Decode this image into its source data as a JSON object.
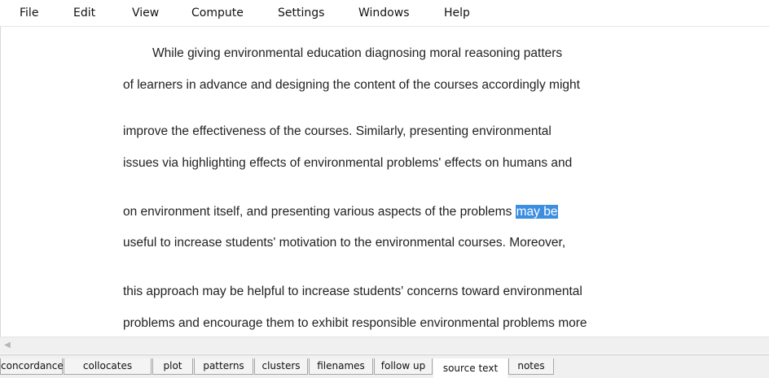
{
  "menu": [
    "File",
    "Edit",
    "View",
    "Compute",
    "Settings",
    "Windows",
    "Help"
  ],
  "text_lines": [
    "While giving environmental education diagnosing moral reasoning patters",
    "of learners in advance and designing the content of the courses accordingly might",
    "improve the effectiveness of the courses. Similarly, presenting environmental",
    "issues via highlighting effects of environmental problems' effects on humans and",
    "on environment itself, and presenting various aspects of the problems ",
    "useful to increase students' motivation to the environmental courses. Moreover,",
    "this approach may be helpful to increase students' concerns toward environmental",
    "problems and encourage them to exhibit responsible environmental problems more"
  ],
  "highlighted_text": "may be",
  "scroll_left_icon": "chevron-left-icon",
  "tabs": [
    "concordance",
    "collocates",
    "plot",
    "patterns",
    "clusters",
    "filenames",
    "follow up",
    "source text",
    "notes"
  ],
  "active_tab": "source text",
  "colors": {
    "selection": "#3c8ee0",
    "text": "#222222"
  }
}
